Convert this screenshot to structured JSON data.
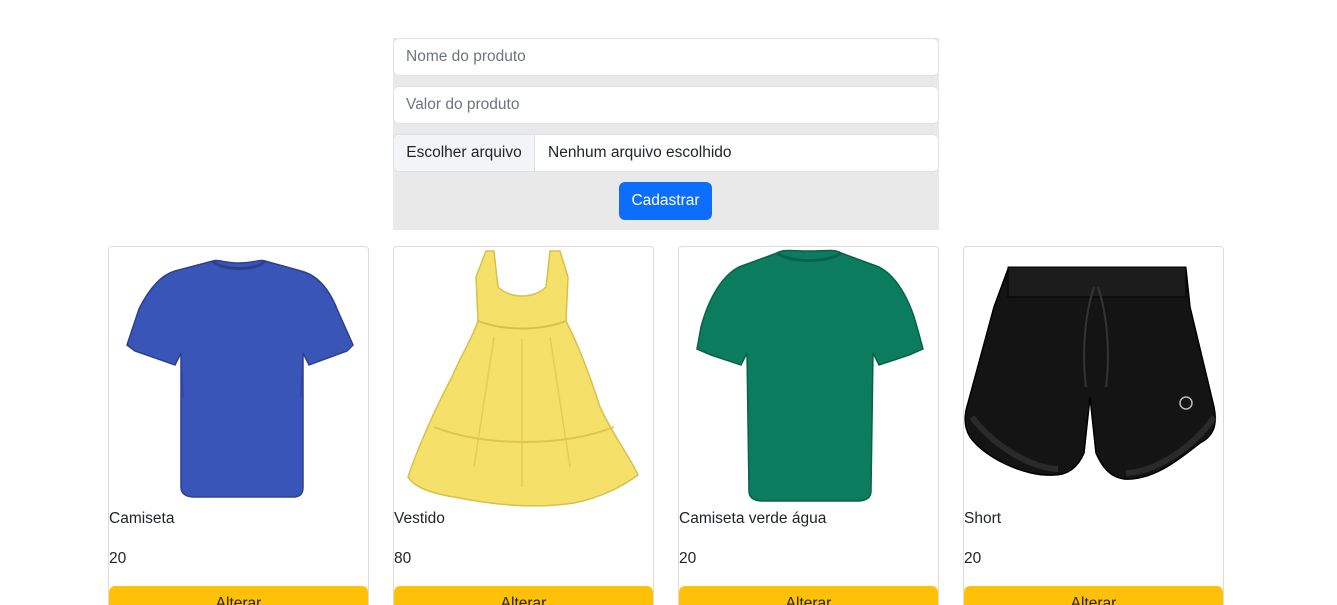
{
  "form": {
    "name_placeholder": "Nome do produto",
    "value_placeholder": "Valor do produto",
    "file_button_label": "Escolher arquivo",
    "file_status": "Nenhum arquivo escolhido",
    "submit_label": "Cadastrar"
  },
  "products": [
    {
      "name": "Camiseta",
      "price": "20",
      "button_label": "Alterar",
      "image": "blue-tshirt",
      "color": "#3a55b8"
    },
    {
      "name": "Vestido",
      "price": "80",
      "button_label": "Alterar",
      "image": "yellow-dress",
      "color": "#f5e06a"
    },
    {
      "name": "Camiseta verde água",
      "price": "20",
      "button_label": "Alterar",
      "image": "green-tshirt",
      "color": "#0b7d5e"
    },
    {
      "name": "Short",
      "price": "20",
      "button_label": "Alterar",
      "image": "black-shorts",
      "color": "#141414"
    }
  ],
  "colors": {
    "primary": "#0d6efd",
    "warning": "#ffc107",
    "panel_bg": "#e9e9e9"
  }
}
